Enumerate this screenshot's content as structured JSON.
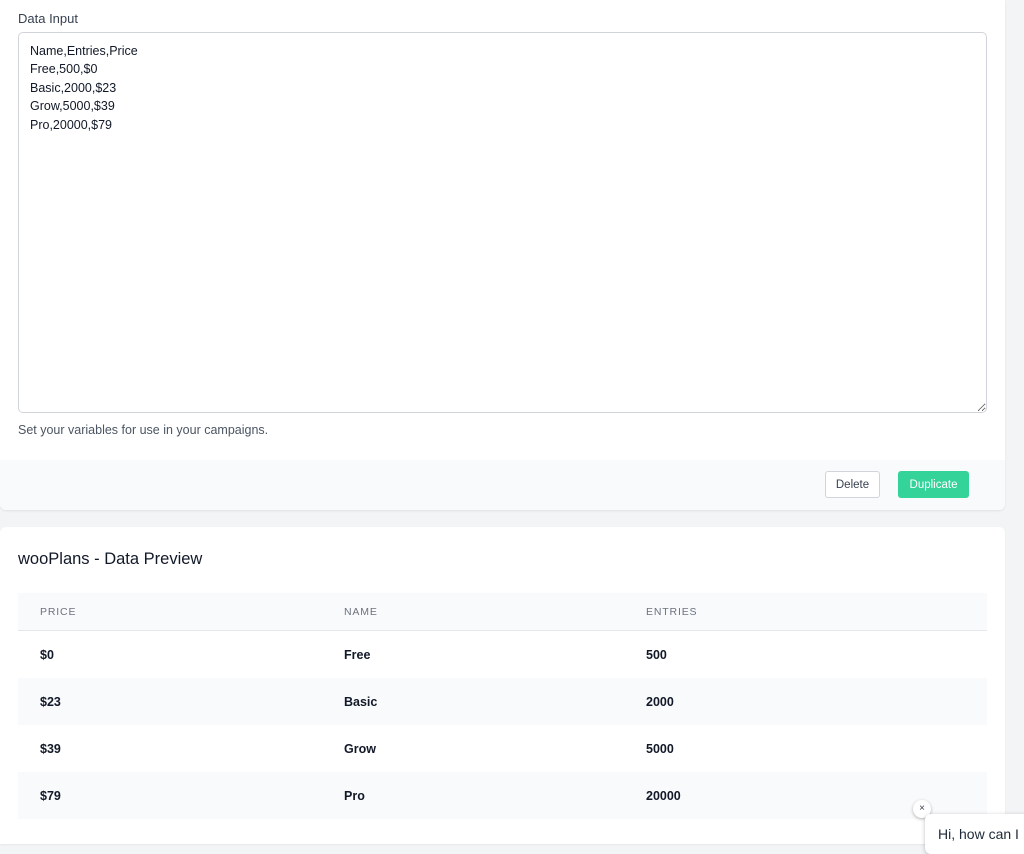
{
  "data_input": {
    "label": "Data Input",
    "value": "Name,Entries,Price\nFree,500,$0\nBasic,2000,$23\nGrow,5000,$39\nPro,20000,$79",
    "help_text": "Set your variables for use in your campaigns."
  },
  "actions": {
    "delete_label": "Delete",
    "duplicate_label": "Duplicate"
  },
  "preview": {
    "title": "wooPlans - Data Preview",
    "columns": [
      "PRICE",
      "NAME",
      "ENTRIES"
    ],
    "rows": [
      [
        "$0",
        "Free",
        "500"
      ],
      [
        "$23",
        "Basic",
        "2000"
      ],
      [
        "$39",
        "Grow",
        "5000"
      ],
      [
        "$79",
        "Pro",
        "20000"
      ]
    ]
  },
  "chat": {
    "close_icon": "×",
    "message": "Hi, how can I"
  },
  "colors": {
    "accent": "#34d399",
    "page_bg": "#f3f4f6"
  }
}
